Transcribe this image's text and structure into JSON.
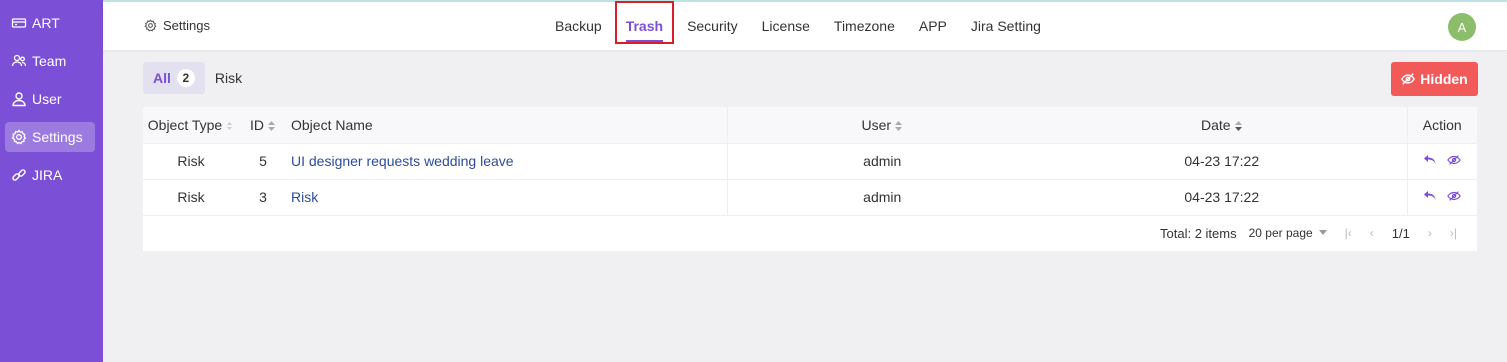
{
  "sidebar": {
    "items": [
      {
        "label": "ART",
        "icon": "art-icon",
        "active": false
      },
      {
        "label": "Team",
        "icon": "team-icon",
        "active": false
      },
      {
        "label": "User",
        "icon": "user-icon",
        "active": false
      },
      {
        "label": "Settings",
        "icon": "gear-icon",
        "active": true
      },
      {
        "label": "JIRA",
        "icon": "jira-icon",
        "active": false
      }
    ],
    "color": "#7b4fd6"
  },
  "header": {
    "breadcrumb": "Settings",
    "tabs": [
      "Backup",
      "Trash",
      "Security",
      "License",
      "Timezone",
      "APP",
      "Jira Setting"
    ],
    "active_tab": "Trash",
    "avatar": "A"
  },
  "filters": {
    "all_label": "All",
    "all_count": "2",
    "risk_label": "Risk"
  },
  "hidden_button": "Hidden",
  "table": {
    "columns": [
      "Object Type",
      "ID",
      "Object Name",
      "User",
      "Date",
      "Action"
    ],
    "rows": [
      {
        "type": "Risk",
        "id": "5",
        "name": "UI designer requests wedding leave",
        "user": "admin",
        "date": "04-23 17:22"
      },
      {
        "type": "Risk",
        "id": "3",
        "name": "Risk",
        "user": "admin",
        "date": "04-23 17:22"
      }
    ]
  },
  "pagination": {
    "total": "Total: 2 items",
    "per_page": "20 per page",
    "page": "1/1"
  },
  "colors": {
    "accent": "#7b4fd6",
    "danger": "#f25a5a",
    "link": "#2e4b9a"
  }
}
